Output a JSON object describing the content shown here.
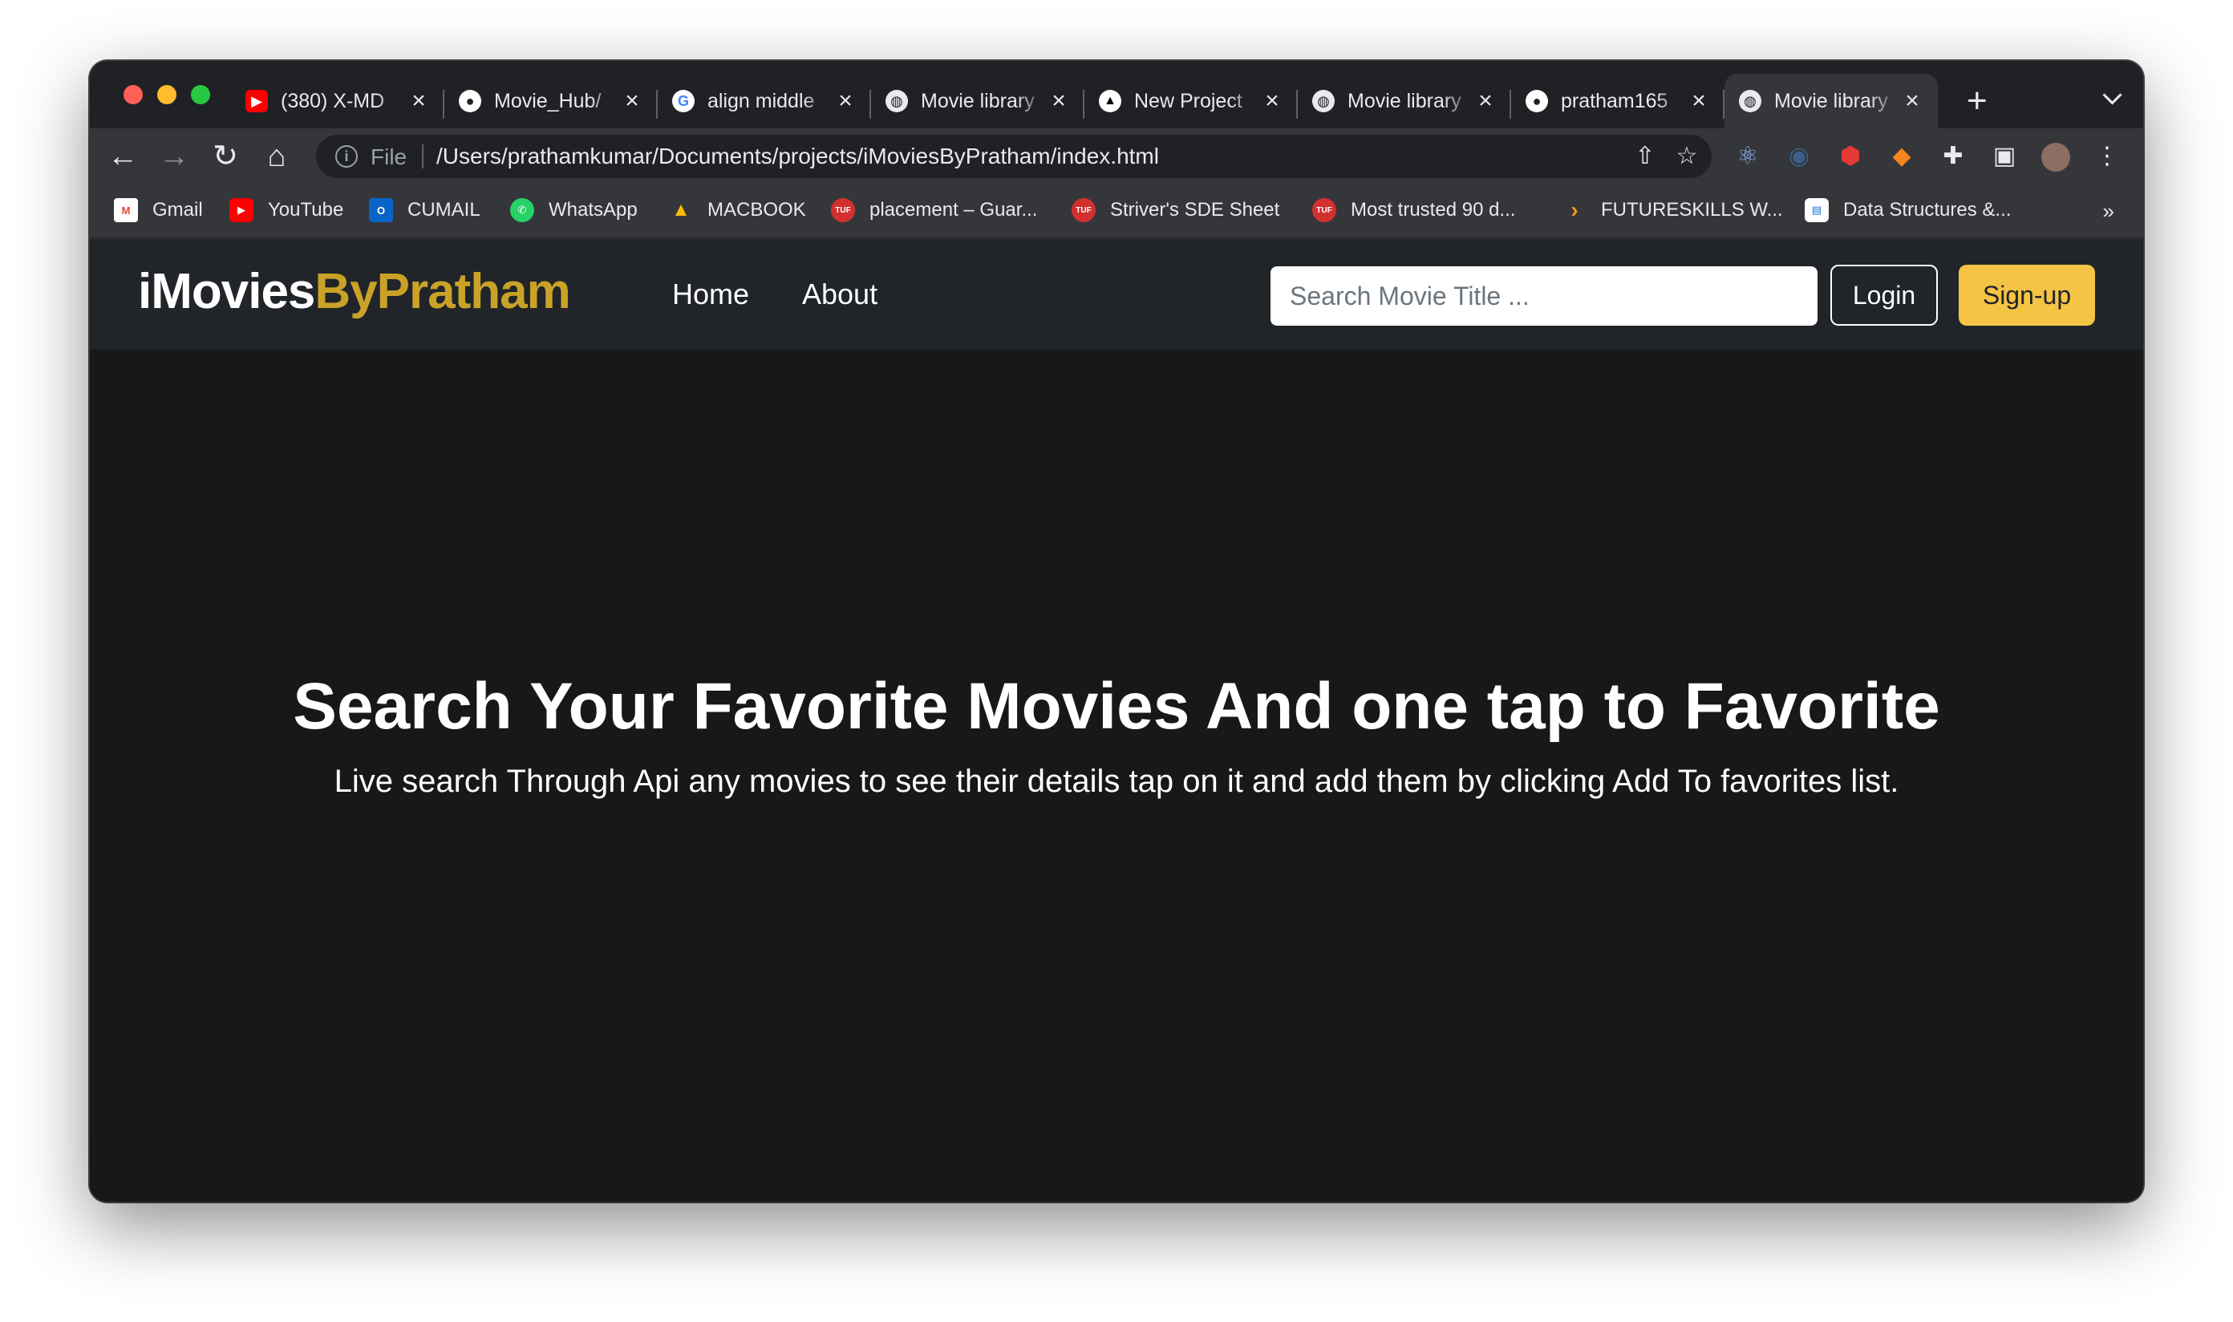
{
  "browser": {
    "tabs": [
      {
        "title": "(380) X-MD",
        "favicon": "youtube-icon",
        "color": "#ff0000"
      },
      {
        "title": "Movie_Hub/",
        "favicon": "github-icon",
        "color": "#ffffff"
      },
      {
        "title": "align middle",
        "favicon": "google-icon",
        "color": "#4285f4"
      },
      {
        "title": "Movie library",
        "favicon": "globe-icon",
        "color": "#e8eaed"
      },
      {
        "title": "New Project",
        "favicon": "vercel-icon",
        "color": "#ffffff"
      },
      {
        "title": "Movie library",
        "favicon": "globe-icon",
        "color": "#e8eaed"
      },
      {
        "title": "pratham165",
        "favicon": "github-icon",
        "color": "#ffffff"
      },
      {
        "title": "Movie library",
        "favicon": "globe-icon",
        "color": "#e8eaed",
        "active": true
      }
    ],
    "address": {
      "scheme": "File",
      "url": "/Users/prathamkumar/Documents/projects/iMoviesByPratham/index.html"
    },
    "bookmarks": [
      {
        "label": "Gmail",
        "icon": "gmail-icon"
      },
      {
        "label": "YouTube",
        "icon": "youtube-icon"
      },
      {
        "label": "CUMAIL",
        "icon": "outlook-icon"
      },
      {
        "label": "WhatsApp",
        "icon": "whatsapp-icon"
      },
      {
        "label": "MACBOOK",
        "icon": "google-drive-icon"
      },
      {
        "label": "placement – Guar...",
        "icon": "tuf-icon"
      },
      {
        "label": "Striver's SDE Sheet",
        "icon": "tuf-icon"
      },
      {
        "label": "Most trusted 90 d...",
        "icon": "tuf-icon"
      },
      {
        "label": "FUTURESKILLS W...",
        "icon": "chevron-right-icon"
      },
      {
        "label": "Data Structures &...",
        "icon": "bookmark-page-icon"
      }
    ],
    "bookmarks_more": "»"
  },
  "site": {
    "brand_first": "iMovies",
    "brand_second": "ByPratham",
    "nav": {
      "home": "Home",
      "about": "About"
    },
    "search_placeholder": "Search Movie Title ...",
    "login_label": "Login",
    "signup_label": "Sign-up",
    "hero": {
      "title": "Search Your Favorite Movies And one tap to Favorite",
      "subtitle": "Live search Through Api any movies to see their details tap on it and add them by clicking Add To favorites list."
    },
    "colors": {
      "brand_accent": "#c9a227",
      "signup_button": "#f6c445",
      "navbar": "#212529",
      "page_bg": "#181818"
    }
  }
}
